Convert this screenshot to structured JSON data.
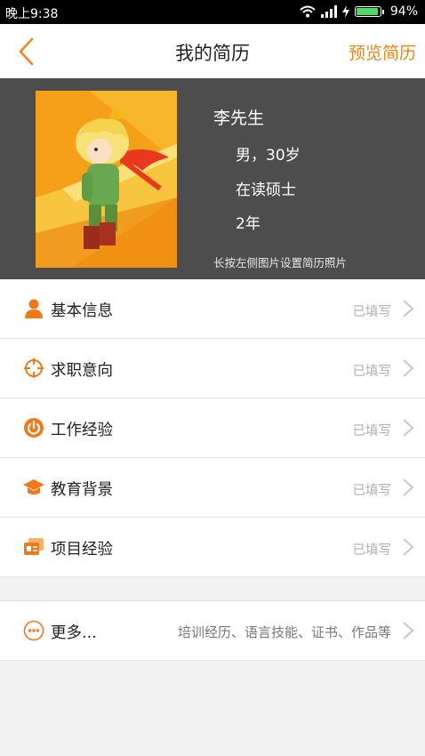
{
  "status_bar": {
    "time": "晚上9:38",
    "battery_percent": "94%",
    "battery_level": 0.94
  },
  "nav": {
    "title": "我的简历",
    "preview": "预览简历"
  },
  "profile": {
    "name": "李先生",
    "gender_age": "男，30岁",
    "education": "在读硕士",
    "experience": "2年",
    "hint": "长按左侧图片设置简历照片"
  },
  "sections": [
    {
      "label": "基本信息",
      "status": "已填写",
      "icon": "person-icon"
    },
    {
      "label": "求职意向",
      "status": "已填写",
      "icon": "target-icon"
    },
    {
      "label": "工作经验",
      "status": "已填写",
      "icon": "power-icon"
    },
    {
      "label": "教育背景",
      "status": "已填写",
      "icon": "graduation-cap-icon"
    },
    {
      "label": "项目经验",
      "status": "已填写",
      "icon": "cards-icon"
    }
  ],
  "more": {
    "label": "更多...",
    "description": "培训经历、语言技能、证书、作品等",
    "icon": "ellipsis-icon"
  },
  "colors": {
    "accent": "#f08519",
    "profile_bg": "#4d4d4d"
  }
}
